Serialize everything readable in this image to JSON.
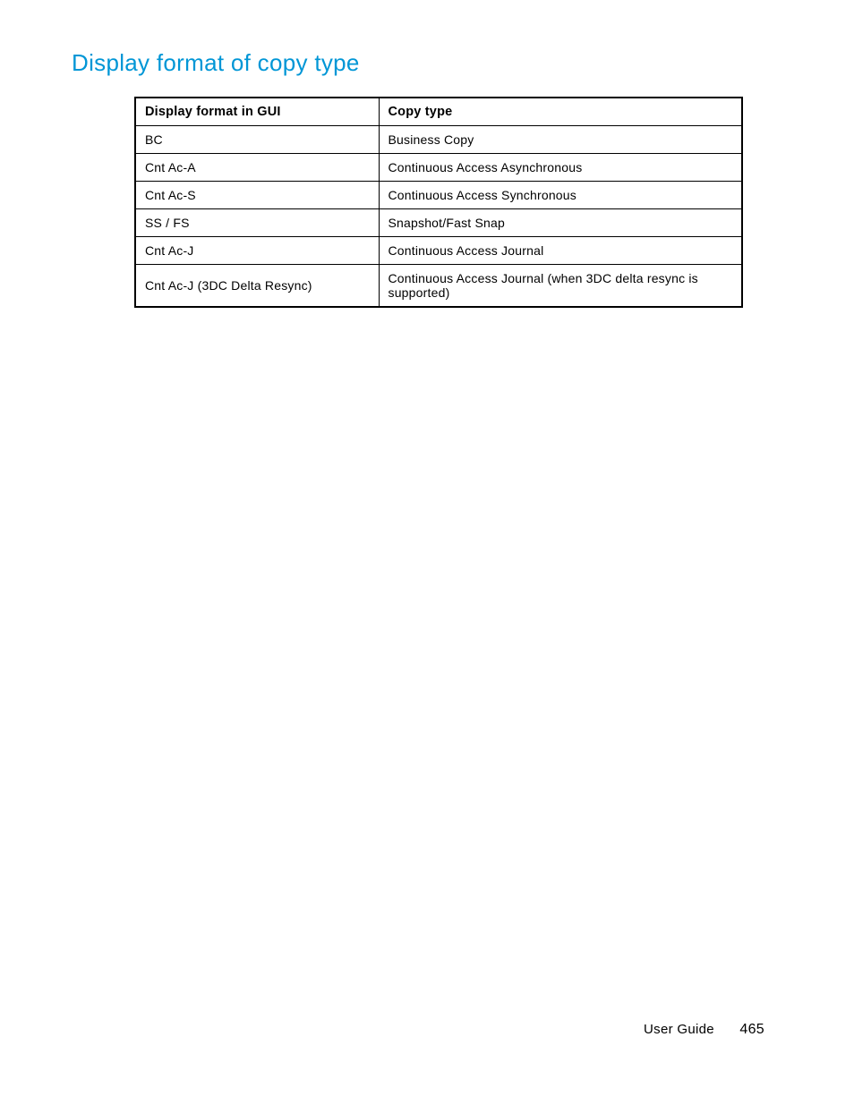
{
  "heading": "Display format of copy type",
  "table": {
    "headers": [
      "Display format in GUI",
      "Copy type"
    ],
    "rows": [
      [
        "BC",
        "Business Copy"
      ],
      [
        "Cnt Ac-A",
        "Continuous Access Asynchronous"
      ],
      [
        "Cnt Ac-S",
        "Continuous Access Synchronous"
      ],
      [
        "SS / FS",
        "Snapshot/Fast Snap"
      ],
      [
        "Cnt Ac-J",
        "Continuous Access Journal"
      ],
      [
        "Cnt Ac-J (3DC Delta Resync)",
        "Continuous Access Journal (when 3DC delta resync is supported)"
      ]
    ]
  },
  "footer": {
    "label": "User Guide",
    "page": "465"
  }
}
